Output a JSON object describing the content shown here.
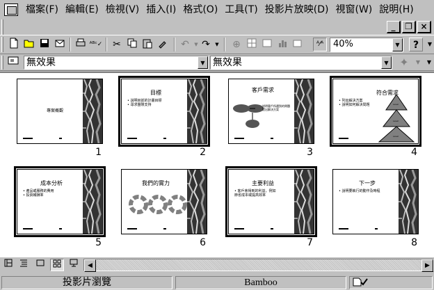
{
  "menubar": {
    "items": [
      "檔案(F)",
      "編輯(E)",
      "檢視(V)",
      "插入(I)",
      "格式(O)",
      "工具(T)",
      "投影片放映(D)",
      "視窗(W)",
      "說明(H)"
    ]
  },
  "window_controls": {
    "minimize": "_",
    "restore": "❐",
    "close": "×"
  },
  "toolbar": {
    "zoom_value": "40%",
    "help_symbol": "?"
  },
  "effects": {
    "transition_effect": "無效果",
    "text_effect": "無效果"
  },
  "slides": [
    {
      "number": "1",
      "title": "專案概觀",
      "bullets": []
    },
    {
      "number": "2",
      "title": "目標",
      "bullets": [
        "說明目前的計畫目標",
        "尋求團隊支持"
      ]
    },
    {
      "number": "3",
      "title": "客戶需求",
      "bullets": [
        "說明客戶所遇到的問題",
        "提出解決方案"
      ]
    },
    {
      "number": "4",
      "title": "符合需求",
      "bullets": [
        "列出解決方案",
        "說明如何解決問題"
      ],
      "levels": [
        "Level",
        "Level",
        "Level"
      ]
    },
    {
      "number": "5",
      "title": "成本分析",
      "bullets": [
        "產品或服務的費用",
        "投資報酬率"
      ]
    },
    {
      "number": "6",
      "title": "我們的實力",
      "bullets": []
    },
    {
      "number": "7",
      "title": "主要利益",
      "bullets": [
        "客戶會得到的利益，例如節省成本或提高效率"
      ]
    },
    {
      "number": "8",
      "title": "下一步",
      "bullets": [
        "說明要執行的動作及時程"
      ]
    }
  ],
  "statusbar": {
    "view_name": "投影片瀏覽",
    "design": "Bamboo"
  }
}
